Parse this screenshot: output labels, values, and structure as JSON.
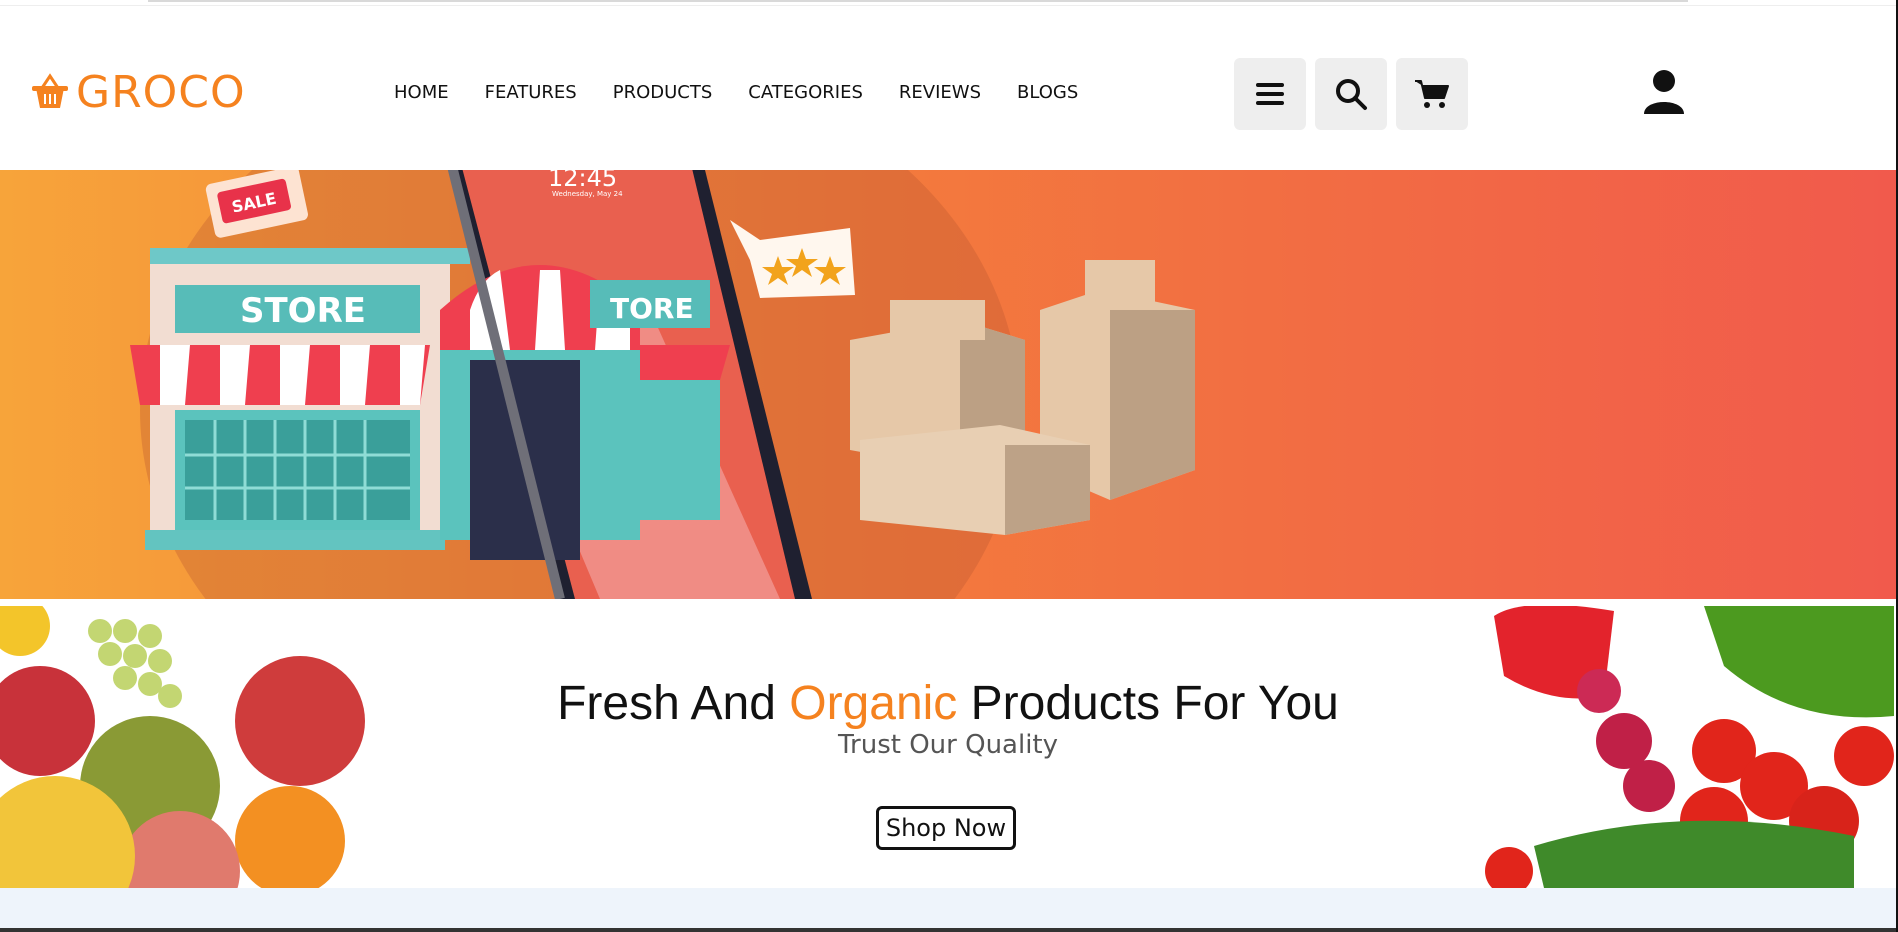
{
  "brand": {
    "name": "GROCO",
    "color": "#f5821f"
  },
  "nav": {
    "items": [
      {
        "label": "HOME"
      },
      {
        "label": "FEATURES"
      },
      {
        "label": "PRODUCTS"
      },
      {
        "label": "CATEGORIES"
      },
      {
        "label": "REVIEWS"
      },
      {
        "label": "BLOGS"
      }
    ]
  },
  "header_actions": {
    "menu_icon": "hamburger-icon",
    "search_icon": "search-icon",
    "cart_icon": "cart-icon",
    "user_icon": "user-icon"
  },
  "hero": {
    "store_sign": "STORE",
    "store_sign_side": "TORE",
    "sale_tag": "SALE",
    "phone_time": "12:45",
    "phone_date": "Wednesday, May 24"
  },
  "fresh": {
    "title_part1": "Fresh And ",
    "title_accent": "Organic",
    "title_part2": " Products For You",
    "subtitle": "Trust Our Quality",
    "cta": "Shop Now"
  }
}
